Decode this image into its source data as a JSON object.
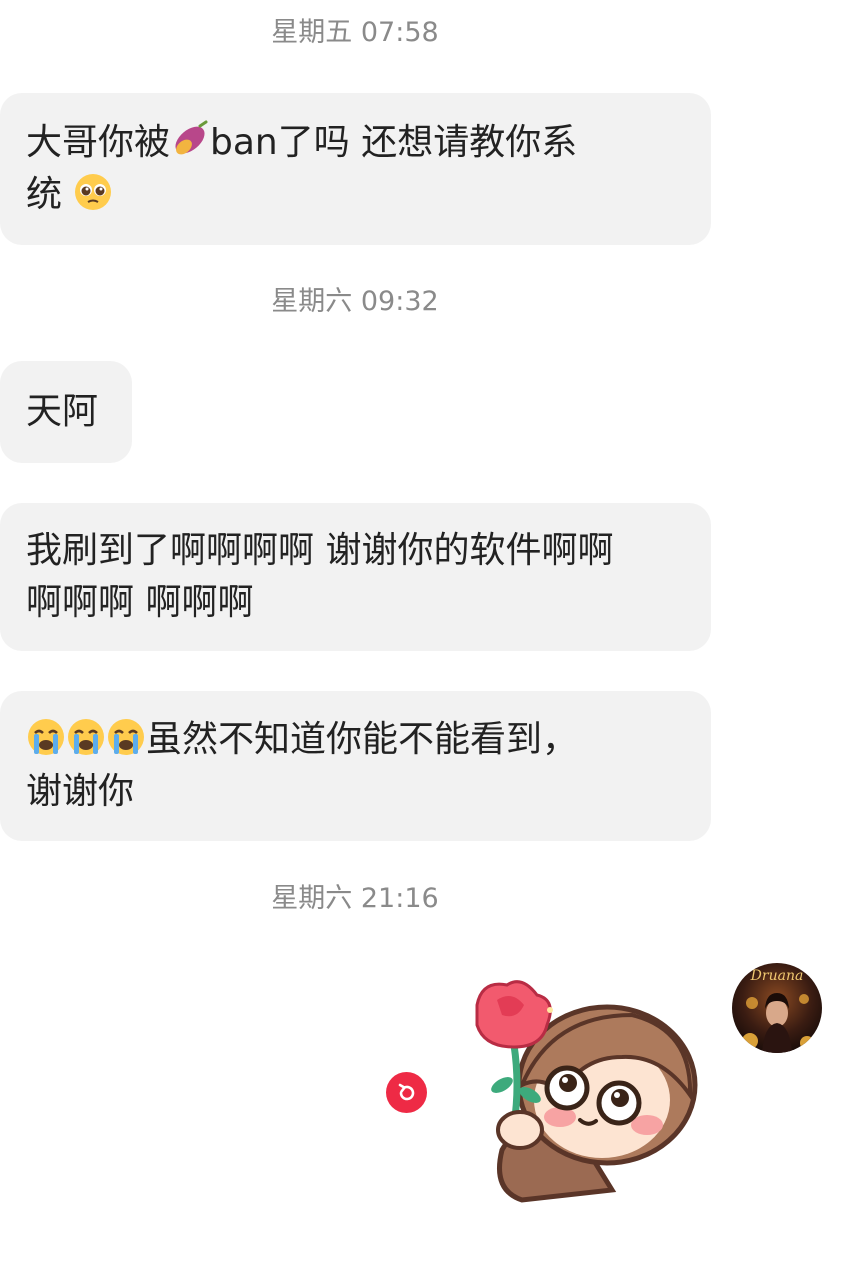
{
  "messages": [
    {
      "timestamp": "星期五 07:58",
      "lines": [
        "大哥你被",
        "ban了吗  还想请教你系",
        "统"
      ]
    },
    {
      "timestamp": "星期六 09:32",
      "lines": [
        "天阿"
      ]
    },
    {
      "lines": [
        "我刷到了啊啊啊啊 谢谢你的软件啊啊",
        "啊啊啊 啊啊啊"
      ]
    },
    {
      "lines": [
        "虽然不知道你能不能看到，",
        "谢谢你"
      ]
    },
    {
      "timestamp": "星期六 21:16",
      "sticker": "girl-holding-rose-sticker"
    }
  ],
  "icons": {
    "sweet_potato": "sweet-potato-emoji",
    "pleading": "pleading-face-emoji",
    "crying": "loudly-crying-face-emoji",
    "resend": "resend-icon"
  },
  "avatar": {
    "label": "Druana"
  },
  "colors": {
    "bubble": "#f2f2f2",
    "timestamp": "#8a8a8a",
    "resend": "#ee2a45"
  }
}
